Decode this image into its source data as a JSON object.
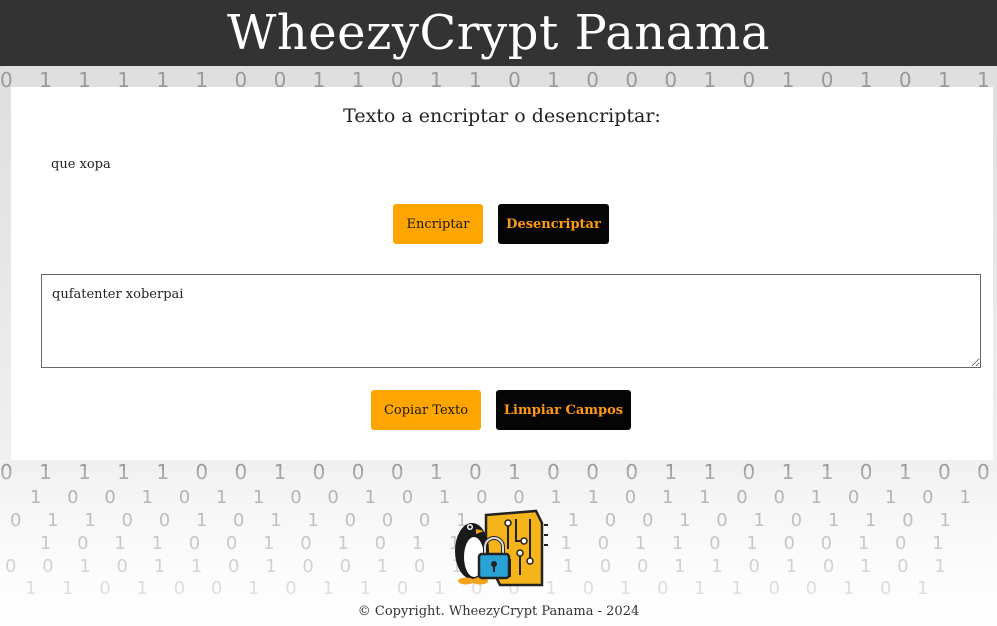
{
  "header": {
    "title": "WheezyCrypt Panama"
  },
  "main": {
    "input_title": "Texto a encriptar o desencriptar:",
    "input_value": "que xopa",
    "encrypt_label": "Encriptar",
    "decrypt_label": "Desencriptar",
    "output_value": "qufatenter xoberpai",
    "copy_label": "Copiar Texto",
    "clear_label": "Limpiar Campos"
  },
  "logo": {
    "icons": [
      "penguin-icon",
      "padlock-icon",
      "circuit-board-icon"
    ]
  },
  "footer": {
    "copyright": "© Copyright. WheezyCrypt Panama - 2024"
  },
  "colors": {
    "header_bg": "#333333",
    "primary_button": "#ffa500",
    "secondary_button_bg": "#050505",
    "secondary_button_text": "#ff9a17"
  }
}
